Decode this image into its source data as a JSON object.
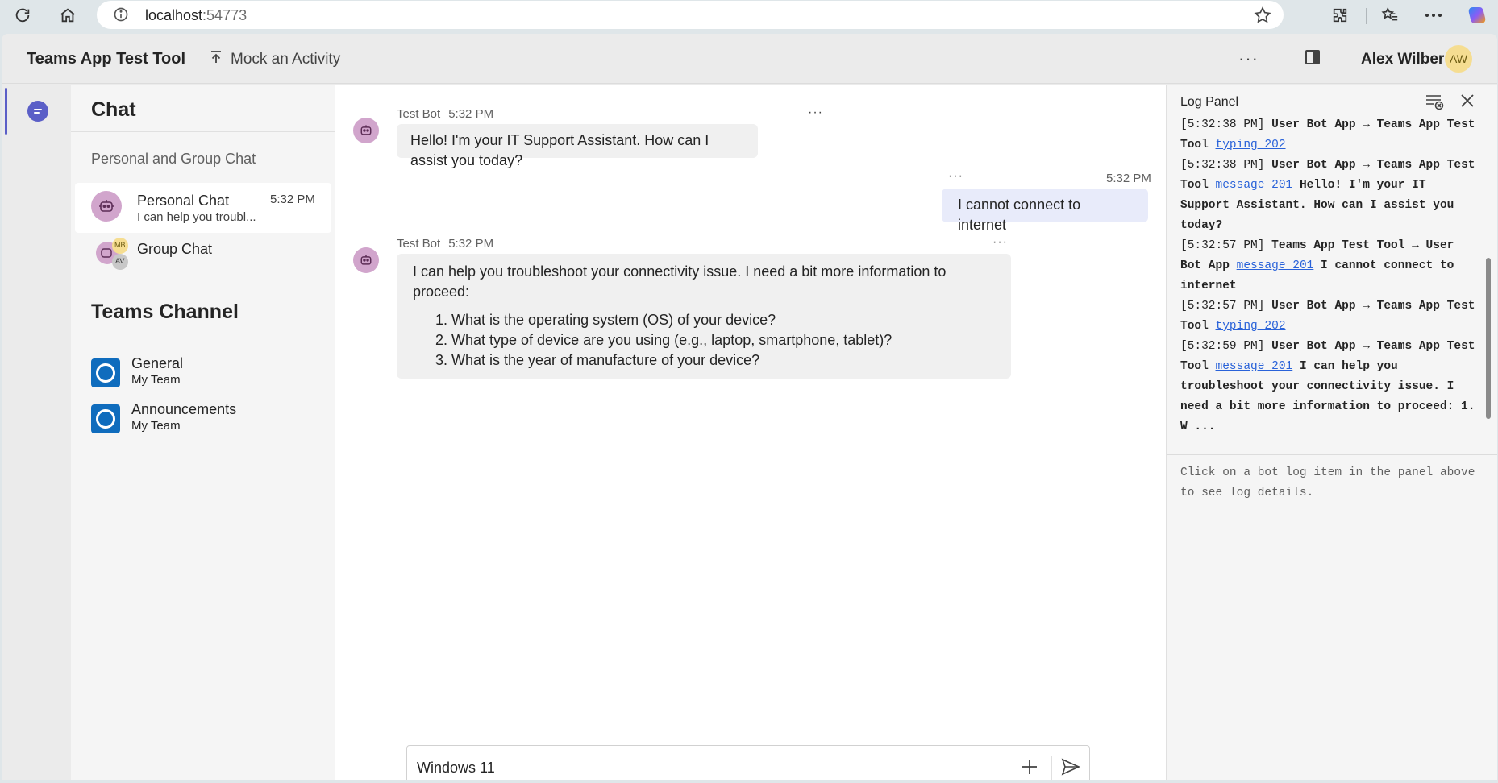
{
  "browser": {
    "url_host": "localhost",
    "url_port": ":54773"
  },
  "app": {
    "title": "Teams App Test Tool",
    "mock_label": "Mock an Activity",
    "more_label": "···",
    "user_name": "Alex Wilber",
    "user_initials": "AW"
  },
  "sidebar": {
    "chat_heading": "Chat",
    "section_label": "Personal and Group Chat",
    "chats": [
      {
        "name": "Personal Chat",
        "time": "5:32 PM",
        "preview": "I can help you troubl..."
      },
      {
        "name": "Group Chat",
        "initials_1": "MB",
        "initials_2": "AV"
      }
    ],
    "teams_heading": "Teams Channel",
    "channels": [
      {
        "name": "General",
        "team": "My Team"
      },
      {
        "name": "Announcements",
        "team": "My Team"
      }
    ]
  },
  "messages": [
    {
      "sender": "Test Bot",
      "time": "5:32 PM",
      "text": "Hello! I'm your IT Support Assistant. How can I assist you today?",
      "more": "···"
    },
    {
      "time": "5:32 PM",
      "text": "I cannot connect to internet",
      "more": "···"
    },
    {
      "sender": "Test Bot",
      "time": "5:32 PM",
      "more": "···",
      "text": "I can help you troubleshoot your connectivity issue. I need a bit more information to proceed:",
      "list": [
        "What is the operating system (OS) of your device?",
        "What type of device are you using (e.g., laptop, smartphone, tablet)?",
        "What is the year of manufacture of your device?"
      ]
    }
  ],
  "composer": {
    "value": "Windows 11"
  },
  "log_panel": {
    "title": "Log Panel",
    "entries": [
      {
        "ts": "[5:32:38 PM]",
        "route": "User Bot App → Teams App Test Tool",
        "link": "typing 202",
        "text": ""
      },
      {
        "ts": "[5:32:38 PM]",
        "route": "User Bot App → Teams App Test Tool",
        "link": "message 201",
        "text": "Hello! I'm your IT Support Assistant. How can I assist you today?"
      },
      {
        "ts": "[5:32:57 PM]",
        "route": "Teams App Test Tool → User Bot App",
        "link": "message 201",
        "text": "I cannot connect to internet"
      },
      {
        "ts": "[5:32:57 PM]",
        "route": "User Bot App → Teams App Test Tool",
        "link": "typing 202",
        "text": ""
      },
      {
        "ts": "[5:32:59 PM]",
        "route": "User Bot App → Teams App Test Tool",
        "link": "message 201",
        "text": "I can help you troubleshoot your connectivity issue. I need a bit more information to proceed: 1. W ..."
      }
    ],
    "hint": "Click on a bot log item in the panel above to see log details."
  }
}
